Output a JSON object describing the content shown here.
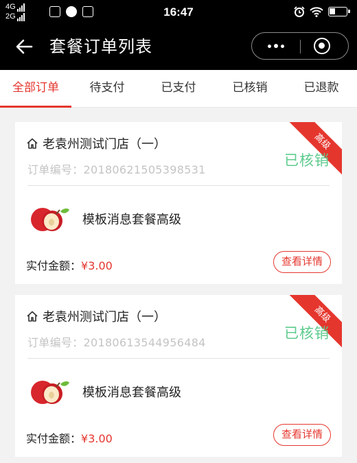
{
  "status_bar": {
    "network_top": "4G",
    "network_bottom": "2G",
    "time": "16:47"
  },
  "nav": {
    "title": "套餐订单列表"
  },
  "tabs": [
    {
      "label": "全部订单",
      "active": true
    },
    {
      "label": "待支付",
      "active": false
    },
    {
      "label": "已支付",
      "active": false
    },
    {
      "label": "已核销",
      "active": false
    },
    {
      "label": "已退款",
      "active": false
    }
  ],
  "orders": [
    {
      "store": "老袁州测试门店（一）",
      "order_no": "订单编号：20180621505398531",
      "status": "已核销",
      "ribbon": "高级",
      "item": "模板消息套餐高级",
      "paid_label": "实付金额：",
      "amount": "¥3.00",
      "detail_button": "查看详情"
    },
    {
      "store": "老袁州测试门店（一）",
      "order_no": "订单编号：20180613544956484",
      "status": "已核销",
      "ribbon": "高级",
      "item": "模板消息套餐高级",
      "paid_label": "实付金额：",
      "amount": "¥3.00",
      "detail_button": "查看详情"
    }
  ],
  "colors": {
    "accent": "#e5362e",
    "status_green": "#5ecb8e",
    "header_bg": "#000000"
  }
}
